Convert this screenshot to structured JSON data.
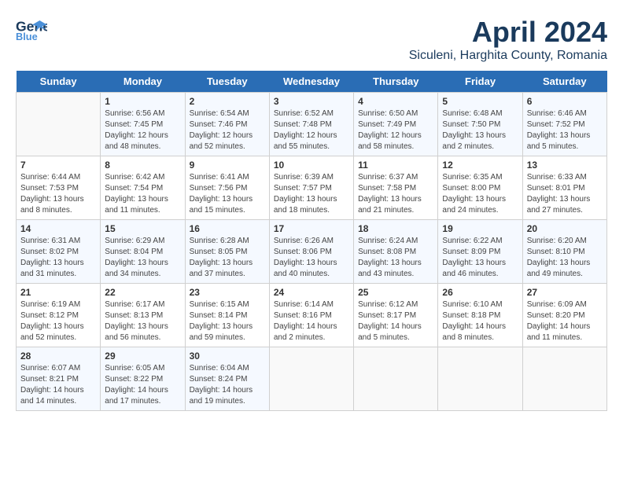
{
  "header": {
    "logo_line1": "General",
    "logo_line2": "Blue",
    "month_title": "April 2024",
    "subtitle": "Siculeni, Harghita County, Romania"
  },
  "days_of_week": [
    "Sunday",
    "Monday",
    "Tuesday",
    "Wednesday",
    "Thursday",
    "Friday",
    "Saturday"
  ],
  "weeks": [
    [
      {
        "day": "",
        "content": ""
      },
      {
        "day": "1",
        "content": "Sunrise: 6:56 AM\nSunset: 7:45 PM\nDaylight: 12 hours\nand 48 minutes."
      },
      {
        "day": "2",
        "content": "Sunrise: 6:54 AM\nSunset: 7:46 PM\nDaylight: 12 hours\nand 52 minutes."
      },
      {
        "day": "3",
        "content": "Sunrise: 6:52 AM\nSunset: 7:48 PM\nDaylight: 12 hours\nand 55 minutes."
      },
      {
        "day": "4",
        "content": "Sunrise: 6:50 AM\nSunset: 7:49 PM\nDaylight: 12 hours\nand 58 minutes."
      },
      {
        "day": "5",
        "content": "Sunrise: 6:48 AM\nSunset: 7:50 PM\nDaylight: 13 hours\nand 2 minutes."
      },
      {
        "day": "6",
        "content": "Sunrise: 6:46 AM\nSunset: 7:52 PM\nDaylight: 13 hours\nand 5 minutes."
      }
    ],
    [
      {
        "day": "7",
        "content": "Sunrise: 6:44 AM\nSunset: 7:53 PM\nDaylight: 13 hours\nand 8 minutes."
      },
      {
        "day": "8",
        "content": "Sunrise: 6:42 AM\nSunset: 7:54 PM\nDaylight: 13 hours\nand 11 minutes."
      },
      {
        "day": "9",
        "content": "Sunrise: 6:41 AM\nSunset: 7:56 PM\nDaylight: 13 hours\nand 15 minutes."
      },
      {
        "day": "10",
        "content": "Sunrise: 6:39 AM\nSunset: 7:57 PM\nDaylight: 13 hours\nand 18 minutes."
      },
      {
        "day": "11",
        "content": "Sunrise: 6:37 AM\nSunset: 7:58 PM\nDaylight: 13 hours\nand 21 minutes."
      },
      {
        "day": "12",
        "content": "Sunrise: 6:35 AM\nSunset: 8:00 PM\nDaylight: 13 hours\nand 24 minutes."
      },
      {
        "day": "13",
        "content": "Sunrise: 6:33 AM\nSunset: 8:01 PM\nDaylight: 13 hours\nand 27 minutes."
      }
    ],
    [
      {
        "day": "14",
        "content": "Sunrise: 6:31 AM\nSunset: 8:02 PM\nDaylight: 13 hours\nand 31 minutes."
      },
      {
        "day": "15",
        "content": "Sunrise: 6:29 AM\nSunset: 8:04 PM\nDaylight: 13 hours\nand 34 minutes."
      },
      {
        "day": "16",
        "content": "Sunrise: 6:28 AM\nSunset: 8:05 PM\nDaylight: 13 hours\nand 37 minutes."
      },
      {
        "day": "17",
        "content": "Sunrise: 6:26 AM\nSunset: 8:06 PM\nDaylight: 13 hours\nand 40 minutes."
      },
      {
        "day": "18",
        "content": "Sunrise: 6:24 AM\nSunset: 8:08 PM\nDaylight: 13 hours\nand 43 minutes."
      },
      {
        "day": "19",
        "content": "Sunrise: 6:22 AM\nSunset: 8:09 PM\nDaylight: 13 hours\nand 46 minutes."
      },
      {
        "day": "20",
        "content": "Sunrise: 6:20 AM\nSunset: 8:10 PM\nDaylight: 13 hours\nand 49 minutes."
      }
    ],
    [
      {
        "day": "21",
        "content": "Sunrise: 6:19 AM\nSunset: 8:12 PM\nDaylight: 13 hours\nand 52 minutes."
      },
      {
        "day": "22",
        "content": "Sunrise: 6:17 AM\nSunset: 8:13 PM\nDaylight: 13 hours\nand 56 minutes."
      },
      {
        "day": "23",
        "content": "Sunrise: 6:15 AM\nSunset: 8:14 PM\nDaylight: 13 hours\nand 59 minutes."
      },
      {
        "day": "24",
        "content": "Sunrise: 6:14 AM\nSunset: 8:16 PM\nDaylight: 14 hours\nand 2 minutes."
      },
      {
        "day": "25",
        "content": "Sunrise: 6:12 AM\nSunset: 8:17 PM\nDaylight: 14 hours\nand 5 minutes."
      },
      {
        "day": "26",
        "content": "Sunrise: 6:10 AM\nSunset: 8:18 PM\nDaylight: 14 hours\nand 8 minutes."
      },
      {
        "day": "27",
        "content": "Sunrise: 6:09 AM\nSunset: 8:20 PM\nDaylight: 14 hours\nand 11 minutes."
      }
    ],
    [
      {
        "day": "28",
        "content": "Sunrise: 6:07 AM\nSunset: 8:21 PM\nDaylight: 14 hours\nand 14 minutes."
      },
      {
        "day": "29",
        "content": "Sunrise: 6:05 AM\nSunset: 8:22 PM\nDaylight: 14 hours\nand 17 minutes."
      },
      {
        "day": "30",
        "content": "Sunrise: 6:04 AM\nSunset: 8:24 PM\nDaylight: 14 hours\nand 19 minutes."
      },
      {
        "day": "",
        "content": ""
      },
      {
        "day": "",
        "content": ""
      },
      {
        "day": "",
        "content": ""
      },
      {
        "day": "",
        "content": ""
      }
    ]
  ]
}
